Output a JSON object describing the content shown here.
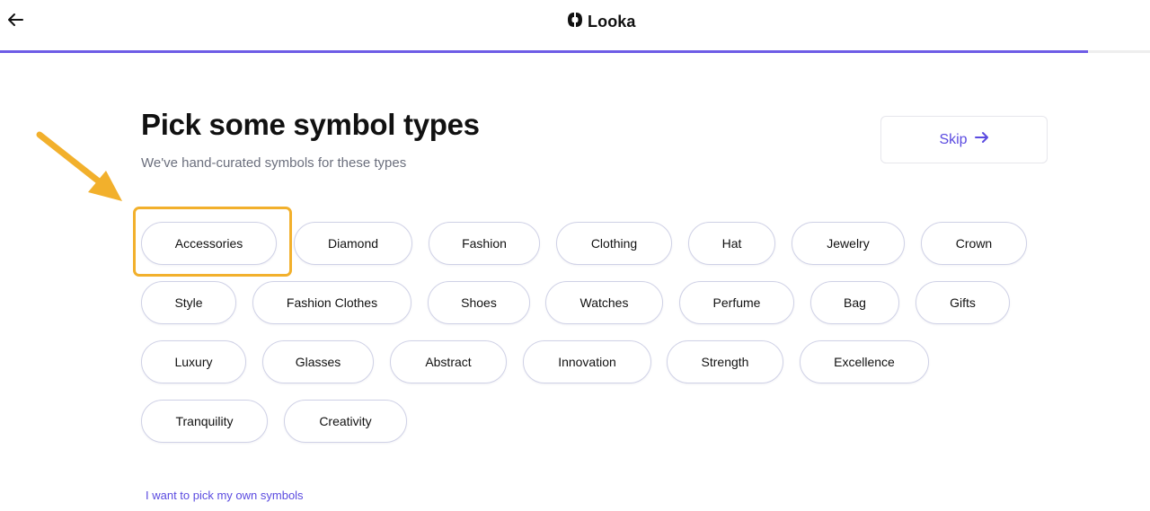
{
  "header": {
    "back_icon": "arrow-left-icon",
    "logo_text": "Looka",
    "logo_icon": "looka-logo-icon",
    "progress": 0.946,
    "accent_color": "#6e5ce6"
  },
  "main": {
    "title": "Pick some symbol types",
    "subtitle": "We've hand-curated symbols for these types",
    "skip_label": "Skip",
    "skip_icon": "arrow-right-icon"
  },
  "chips": {
    "row1": [
      "Accessories",
      "Diamond",
      "Fashion",
      "Clothing",
      "Hat",
      "Jewelry",
      "Crown"
    ],
    "row2": [
      "Style",
      "Fashion Clothes",
      "Shoes",
      "Watches",
      "Perfume",
      "Bag",
      "Gifts"
    ],
    "row3": [
      "Luxury",
      "Glasses",
      "Abstract",
      "Innovation",
      "Strength",
      "Excellence"
    ],
    "row4": [
      "Tranquility",
      "Creativity"
    ]
  },
  "annotation": {
    "highlight_color": "#f2b02c",
    "highlighted_chip": "Accessories"
  },
  "footer": {
    "own_symbols_link": "I want to pick my own symbols"
  }
}
